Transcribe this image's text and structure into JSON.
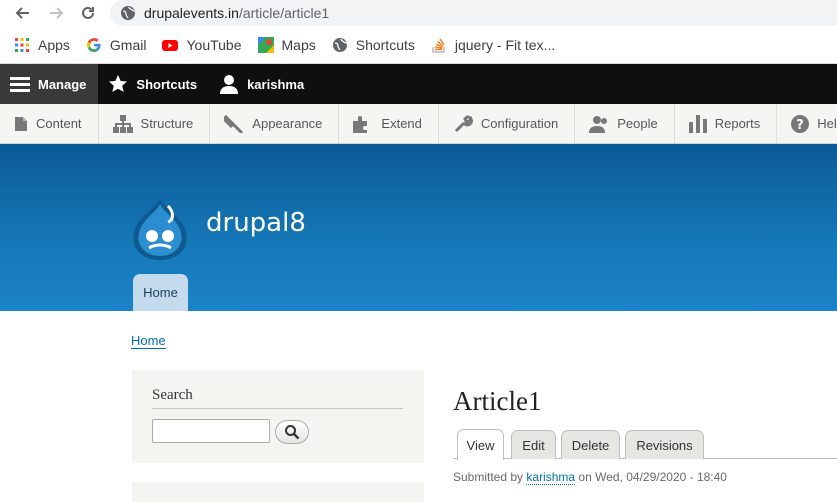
{
  "browser": {
    "url_host": "drupalevents.in",
    "url_path": "/article/article1",
    "bookmarks": [
      {
        "label": "Apps",
        "icon": "apps-grid-icon"
      },
      {
        "label": "Gmail",
        "icon": "google-g-icon"
      },
      {
        "label": "YouTube",
        "icon": "youtube-icon"
      },
      {
        "label": "Maps",
        "icon": "maps-icon"
      },
      {
        "label": "Shortcuts",
        "icon": "globe-icon"
      },
      {
        "label": "jquery - Fit tex...",
        "icon": "stackoverflow-icon"
      }
    ]
  },
  "toolbar": {
    "manage": "Manage",
    "shortcuts": "Shortcuts",
    "user": "karishma"
  },
  "admin_menu": [
    {
      "label": "Content",
      "icon": "content-icon"
    },
    {
      "label": "Structure",
      "icon": "structure-icon"
    },
    {
      "label": "Appearance",
      "icon": "appearance-icon"
    },
    {
      "label": "Extend",
      "icon": "extend-icon"
    },
    {
      "label": "Configuration",
      "icon": "wrench-icon"
    },
    {
      "label": "People",
      "icon": "people-icon"
    },
    {
      "label": "Reports",
      "icon": "reports-icon"
    },
    {
      "label": "Help",
      "icon": "help-icon"
    }
  ],
  "site": {
    "name": "drupal8",
    "home_tab": "Home"
  },
  "breadcrumb": "Home",
  "search": {
    "title": "Search",
    "value": ""
  },
  "article": {
    "title": "Article1",
    "tabs": [
      "View",
      "Edit",
      "Delete",
      "Revisions"
    ],
    "submitted_prefix": "Submitted by",
    "author": "karishma",
    "submitted_suffix": "on Wed, 04/29/2020 - 18:40"
  },
  "colors": {
    "header_top": "#0c5a95",
    "header_bottom": "#1b83c8",
    "link": "#0071b3"
  }
}
